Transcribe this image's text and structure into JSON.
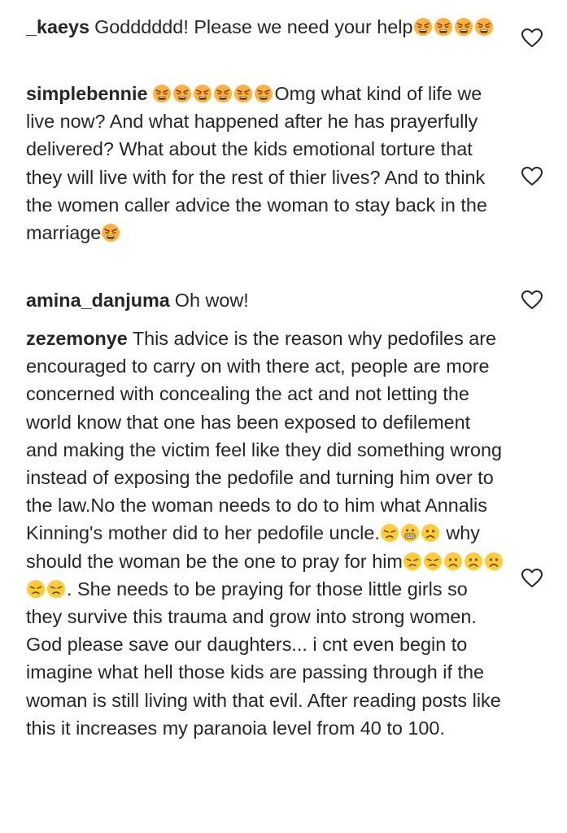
{
  "comments": [
    {
      "username": "_kaeys",
      "parts": [
        {
          "text": "Godddddd! Please we need your help"
        },
        {
          "emoji": "angry"
        },
        {
          "emoji": "angry"
        },
        {
          "emoji": "angry"
        },
        {
          "emoji": "angry"
        }
      ]
    },
    {
      "username": "simplebennie",
      "parts": [
        {
          "emoji": "angry"
        },
        {
          "emoji": "angry"
        },
        {
          "emoji": "angry"
        },
        {
          "emoji": "angry"
        },
        {
          "emoji": "angry"
        },
        {
          "emoji": "angry"
        },
        {
          "text": "Omg what kind of life we live now? And what happened after he has prayerfully delivered? What about the kids emotional torture that they will live with for the rest of thier lives? And to think the women caller advice the woman to stay back in the marriage"
        },
        {
          "emoji": "angry"
        }
      ]
    },
    {
      "username": "amina_danjuma",
      "parts": [
        {
          "text": "Oh wow!"
        }
      ]
    },
    {
      "username": "zezemonye",
      "parts": [
        {
          "text": "This advice is the reason why pedofiles are encouraged to carry on with there act, people are more concerned with concealing the act and not letting the world know that one has been exposed to defilement and making the victim feel like they did something wrong instead of exposing the pedofile and turning him over to the law.No the woman needs to do to him what Annalis Kinning's mother did to her pedofile uncle."
        },
        {
          "emoji": "unamused"
        },
        {
          "emoji": "grimace"
        },
        {
          "emoji": "frown"
        },
        {
          "text": " why should the woman be the one to pray for him"
        },
        {
          "emoji": "unamused"
        },
        {
          "emoji": "unamused"
        },
        {
          "emoji": "frown"
        },
        {
          "emoji": "frown"
        },
        {
          "emoji": "frown"
        },
        {
          "emoji": "unamused"
        },
        {
          "emoji": "unamused"
        },
        {
          "text": ". She needs to be praying for those little girls so they survive this trauma and grow into strong women. God please save our daughters... i cnt even begin to imagine what hell those kids are passing through if the woman is still living with that evil. After reading posts like this it increases my paranoia level from 40 to 100."
        }
      ]
    }
  ]
}
